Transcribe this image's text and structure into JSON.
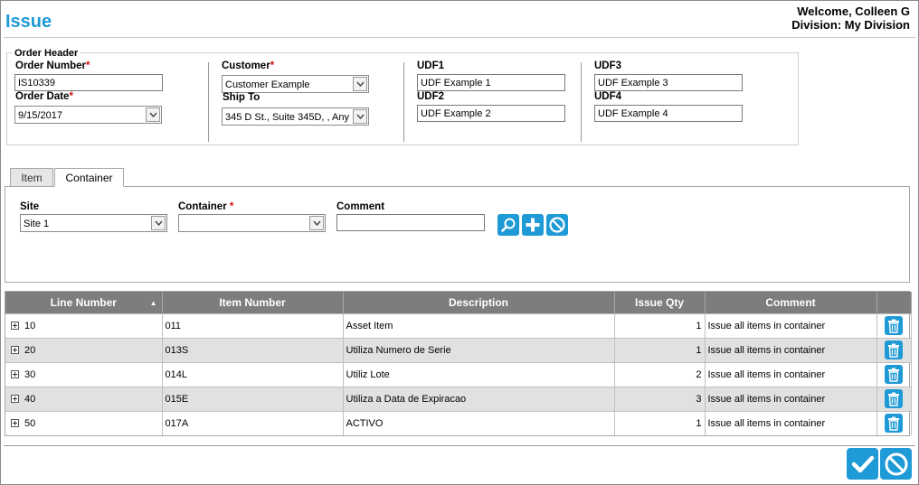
{
  "page": {
    "title": "Issue"
  },
  "user": {
    "welcome": "Welcome, Colleen G",
    "division": "Division: My Division"
  },
  "order_header": {
    "legend": "Order Header",
    "order_number_label": "Order Number",
    "order_number_value": "IS10339",
    "order_date_label": "Order Date",
    "order_date_value": "9/15/2017",
    "customer_label": "Customer",
    "customer_value": "Customer Example",
    "ship_to_label": "Ship To",
    "ship_to_value": "345 D St., Suite 345D, , Any",
    "udf1_label": "UDF1",
    "udf1_value": "UDF Example 1",
    "udf2_label": "UDF2",
    "udf2_value": "UDF Example 2",
    "udf3_label": "UDF3",
    "udf3_value": "UDF Example 3",
    "udf4_label": "UDF4",
    "udf4_value": "UDF Example 4",
    "required_mark": "*"
  },
  "tabs": [
    {
      "label": "Item",
      "active": false
    },
    {
      "label": "Container",
      "active": true
    }
  ],
  "container_panel": {
    "site_label": "Site",
    "site_value": "Site 1",
    "container_label": "Container",
    "container_value": "",
    "comment_label": "Comment",
    "comment_value": "",
    "actions": [
      "search-icon",
      "plus-icon",
      "cancel-icon"
    ]
  },
  "grid": {
    "columns": [
      "Line Number",
      "Item Number",
      "Description",
      "Issue Qty",
      "Comment",
      ""
    ],
    "sort_indicator": "▲",
    "rows": [
      {
        "line": "10",
        "item": "011",
        "description": "Asset Item",
        "qty": "1",
        "comment": "Issue all items in container"
      },
      {
        "line": "20",
        "item": "013S",
        "description": "Utiliza Numero de Serie",
        "qty": "1",
        "comment": "Issue all items in container"
      },
      {
        "line": "30",
        "item": "014L",
        "description": "Utiliz Lote",
        "qty": "2",
        "comment": "Issue all items in container"
      },
      {
        "line": "40",
        "item": "015E",
        "description": "Utiliza a Data de Expiracao",
        "qty": "3",
        "comment": "Issue all items in container"
      },
      {
        "line": "50",
        "item": "017A",
        "description": "ACTIVO",
        "qty": "1",
        "comment": "Issue all items in container"
      }
    ]
  },
  "footer_actions": [
    "check-icon",
    "cancel-icon"
  ],
  "colors": {
    "accent": "#1e9ad6",
    "header_bg": "#7d7d7d",
    "alt_row": "#e1e1e1",
    "required": "#d01010"
  }
}
